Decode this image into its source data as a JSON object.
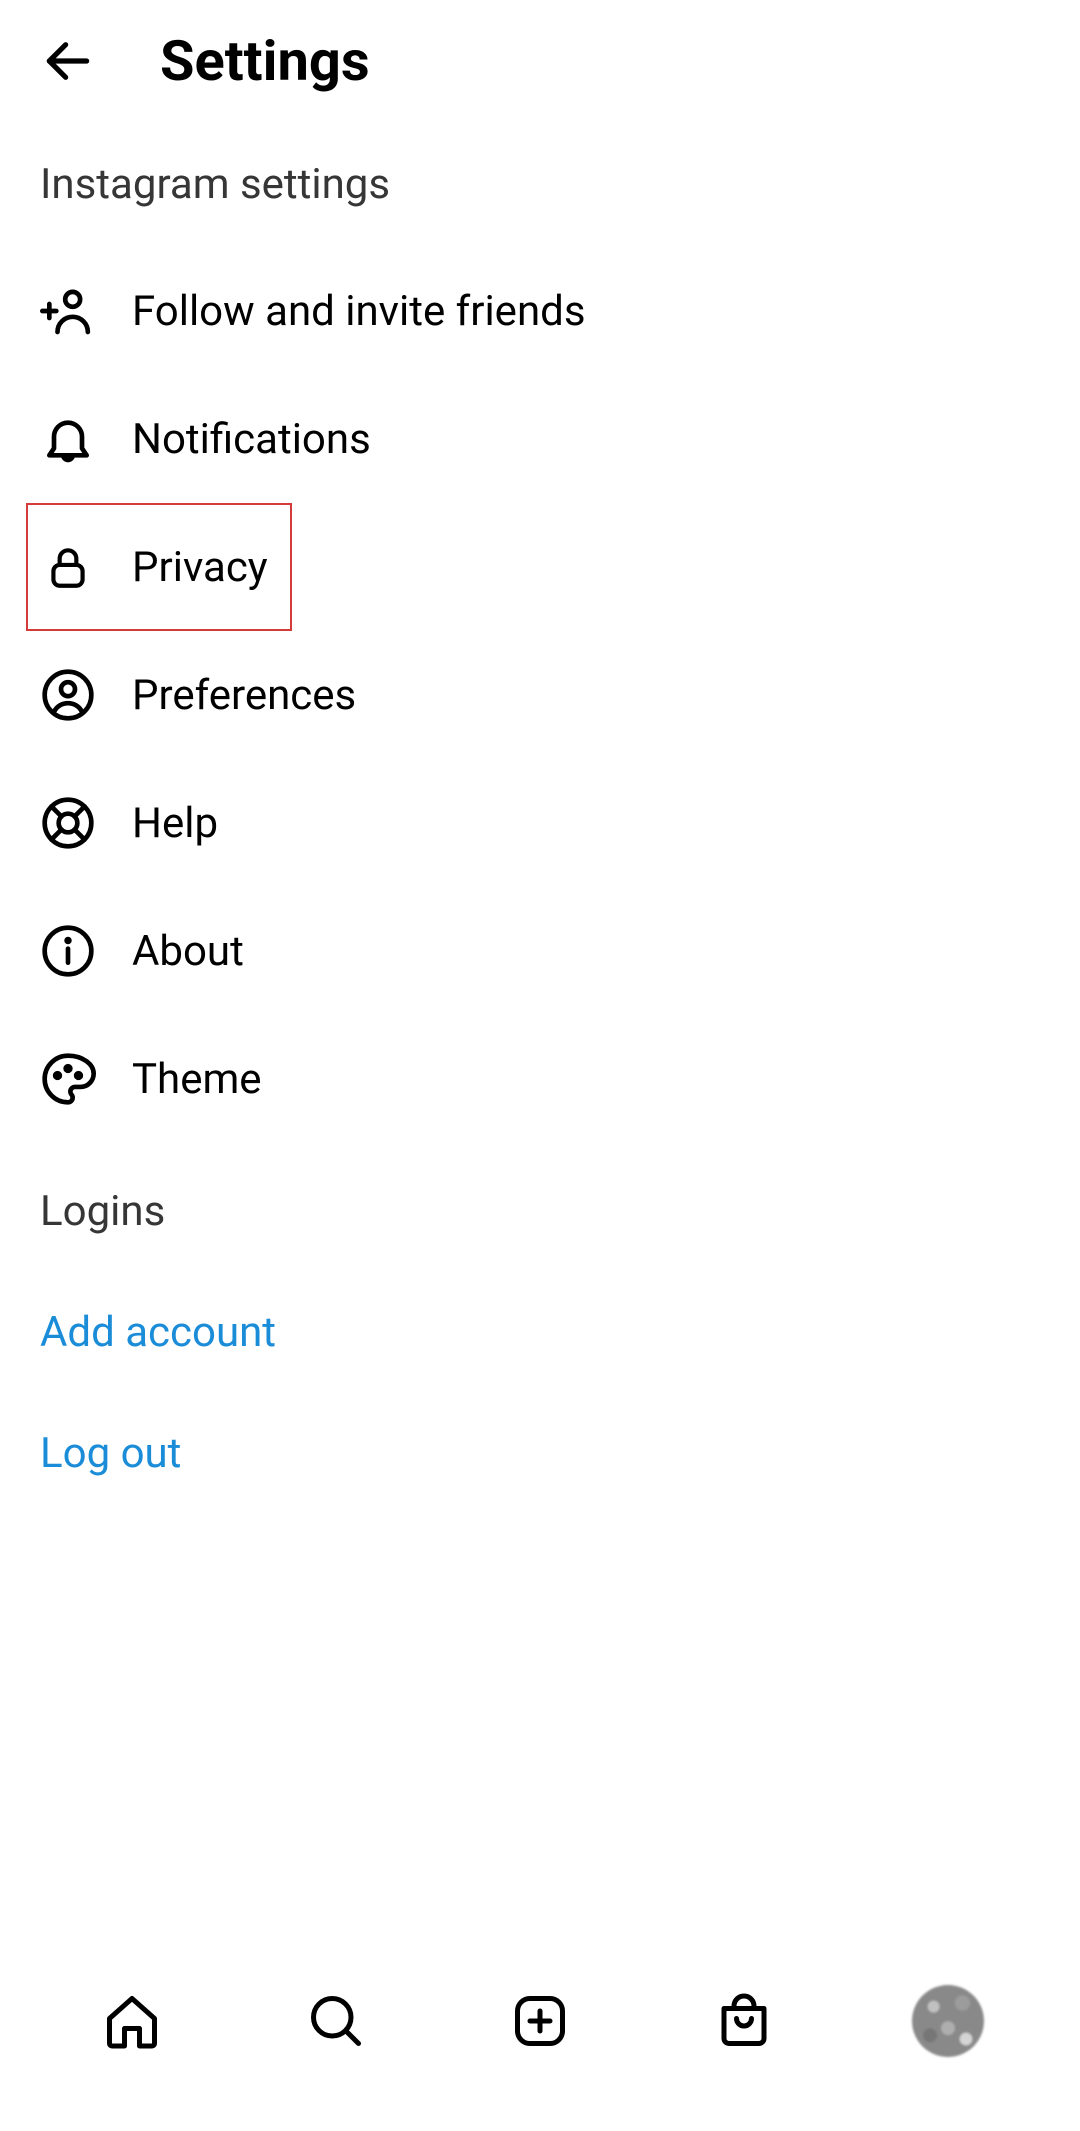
{
  "header": {
    "title": "Settings"
  },
  "subheading": "Instagram settings",
  "menu": [
    {
      "label": "Follow and invite friends",
      "icon": "person-add-icon",
      "highlighted": false
    },
    {
      "label": "Notifications",
      "icon": "bell-icon",
      "highlighted": false
    },
    {
      "label": "Privacy",
      "icon": "lock-icon",
      "highlighted": true
    },
    {
      "label": "Preferences",
      "icon": "user-circle-icon",
      "highlighted": false
    },
    {
      "label": "Help",
      "icon": "lifebuoy-icon",
      "highlighted": false
    },
    {
      "label": "About",
      "icon": "info-icon",
      "highlighted": false
    },
    {
      "label": "Theme",
      "icon": "palette-icon",
      "highlighted": false
    }
  ],
  "logins": {
    "heading": "Logins",
    "add_account": "Add account",
    "log_out": "Log out"
  },
  "colors": {
    "link": "#1a8cd8",
    "highlight_border": "#d43b3b"
  }
}
